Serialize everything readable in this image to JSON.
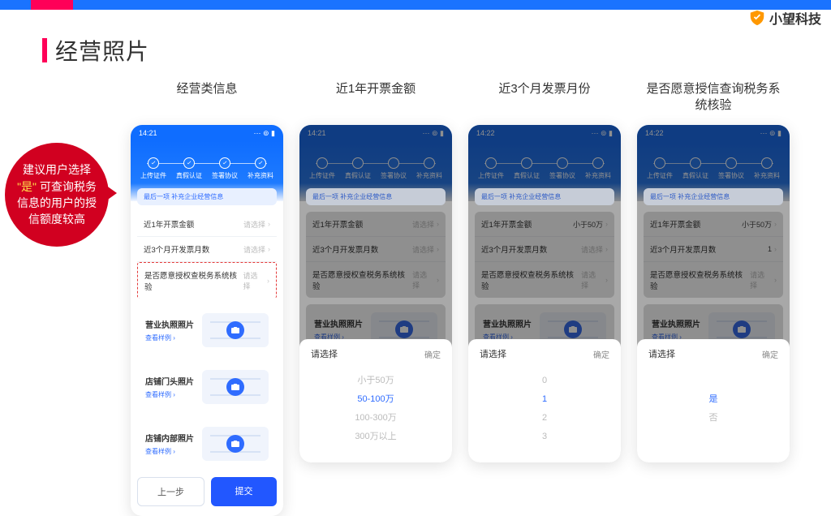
{
  "brand": "小望科技",
  "page_title": "经营照片",
  "bubble": {
    "pre": "建议用户选择",
    "quote": "\"是\"",
    "post": "可查询税务信息的用户的授信额度较高"
  },
  "columns": [
    {
      "title": "经营类信息"
    },
    {
      "title": "近1年开票金额"
    },
    {
      "title": "近3个月发票月份"
    },
    {
      "title": "是否愿意授信查询税务系统核验"
    }
  ],
  "status_times": [
    "14:21",
    "14:21",
    "14:22",
    "14:22"
  ],
  "steps": [
    "上传证件",
    "真假认证",
    "签署协议",
    "补充资料"
  ],
  "banner": "最后一项 补充企业经营信息",
  "rows": {
    "r1": "近1年开票金额",
    "r2": "近3个月开发票月数",
    "r3": "是否愿意授权查税务系统核验",
    "placeholder": "请选择",
    "val_amount": "小于50万",
    "val_months": "1"
  },
  "cards": {
    "c1": "营业执照照片",
    "c2": "店铺门头照片",
    "c3": "店铺内部照片",
    "link": "查看样例"
  },
  "buttons": {
    "prev": "上一步",
    "submit": "提交"
  },
  "picker": {
    "title": "请选择",
    "ok": "确定",
    "amount_options": [
      "小于50万",
      "50-100万",
      "100-300万",
      "300万以上"
    ],
    "month_options": [
      "0",
      "1",
      "2",
      "3"
    ],
    "yes_options": [
      "是",
      "否"
    ]
  }
}
